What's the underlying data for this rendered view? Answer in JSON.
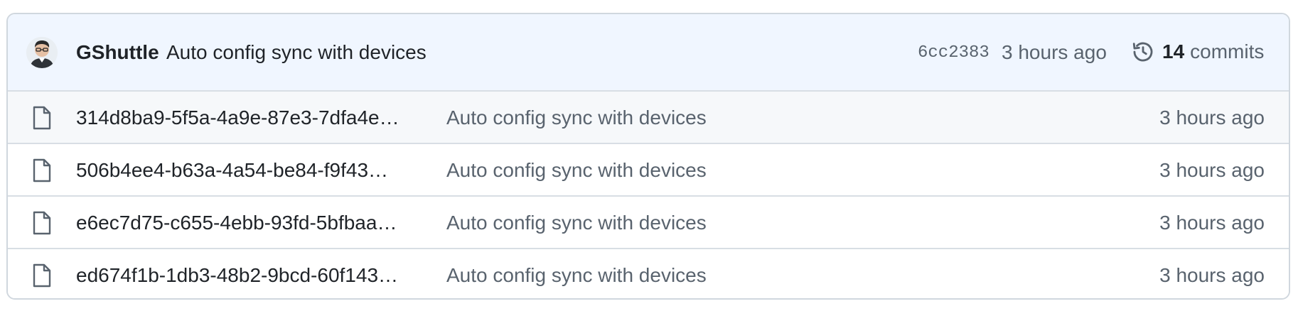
{
  "commit": {
    "author": "GShuttle",
    "message": "Auto config sync with devices",
    "sha": "6cc2383",
    "time": "3 hours ago",
    "commit_count": "14",
    "commit_count_label": "commits"
  },
  "files": [
    {
      "name": "314d8ba9-5f5a-4a9e-87e3-7dfa4e…",
      "commit_message": "Auto config sync with devices",
      "time": "3 hours ago"
    },
    {
      "name": "506b4ee4-b63a-4a54-be84-f9f43…",
      "commit_message": "Auto config sync with devices",
      "time": "3 hours ago"
    },
    {
      "name": "e6ec7d75-c655-4ebb-93fd-5bfbaa…",
      "commit_message": "Auto config sync with devices",
      "time": "3 hours ago"
    },
    {
      "name": "ed674f1b-1db3-48b2-9bcd-60f143…",
      "commit_message": "Auto config sync with devices",
      "time": "3 hours ago"
    }
  ],
  "icons": {
    "avatar": "user-avatar",
    "history": "history-icon",
    "file": "file-icon"
  },
  "colors": {
    "header_background": "#f0f6ff",
    "border": "#d0d7de",
    "text_primary": "#1f2328",
    "text_muted": "#59636e"
  }
}
